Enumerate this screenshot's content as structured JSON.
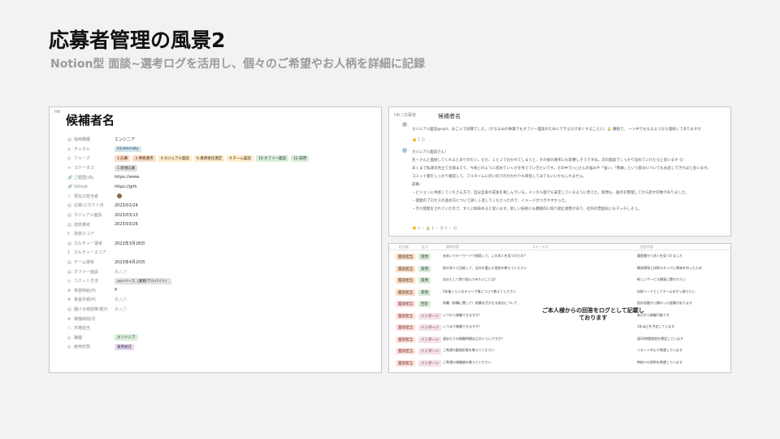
{
  "slide": {
    "title": "応募者管理の風景2",
    "subtitle": "Notion型 面談~選考ログを活用し、個々のご希望やお人柄を詳細に記録"
  },
  "left_panel": {
    "top_label": "HR",
    "page_title": "候補者名",
    "properties": [
      {
        "icon": "▤",
        "name": "採用職種",
        "values": [
          {
            "text": "エンジニア",
            "color": "plain"
          }
        ]
      },
      {
        "icon": "◎",
        "name": "チャネル",
        "values": [
          {
            "text": "01referralty",
            "color": "blue"
          }
        ]
      },
      {
        "icon": "◎",
        "name": "フェーズ",
        "values": [
          {
            "text": "1.応募",
            "color": "orange"
          },
          {
            "text": "3.事務選考",
            "color": "orange"
          },
          {
            "text": "4.カジュアル面談",
            "color": "yellow"
          },
          {
            "text": "6.業務委託選定",
            "color": "yellow"
          },
          {
            "text": "9.チーム面談",
            "color": "yellow"
          },
          {
            "text": "10.オファー面談",
            "color": "green"
          },
          {
            "text": "12.取用",
            "color": "green"
          }
        ]
      },
      {
        "icon": "✳",
        "name": "ステータス",
        "values": [
          {
            "text": "1.新規応募",
            "color": "gray"
          }
        ]
      },
      {
        "icon": "🔗",
        "name": "ご経歴URL",
        "values": [
          {
            "text": "https://www.",
            "color": "plain"
          }
        ]
      },
      {
        "icon": "🔗",
        "name": "Github",
        "values": [
          {
            "text": "https://gith",
            "color": "plain"
          }
        ]
      },
      {
        "icon": "⚇",
        "name": "現在の担当者",
        "values": [
          {
            "text": "",
            "color": "plain"
          }
        ]
      },
      {
        "icon": "▤",
        "name": "応募/スカウト日",
        "values": [
          {
            "text": "2023/02/24",
            "color": "plain"
          }
        ]
      },
      {
        "icon": "▤",
        "name": "カジュアル面談",
        "values": [
          {
            "text": "2023/03/13",
            "color": "plain"
          }
        ]
      },
      {
        "icon": "▤",
        "name": "技術選考",
        "values": [
          {
            "text": "2023/03/26",
            "color": "plain"
          }
        ]
      },
      {
        "icon": "Σ",
        "name": "技術スコア",
        "values": [
          {
            "text": "",
            "color": "plain"
          }
        ]
      },
      {
        "icon": "▤",
        "name": "カルチャー選考",
        "values": [
          {
            "text": "2023年3月26日",
            "color": "plain"
          }
        ]
      },
      {
        "icon": "Σ",
        "name": "カルチャースコア",
        "values": [
          {
            "text": "",
            "color": "plain"
          }
        ]
      },
      {
        "icon": "▤",
        "name": "チーム選考",
        "values": [
          {
            "text": "2023年4月20日",
            "color": "plain"
          }
        ]
      },
      {
        "icon": "▤",
        "name": "オファー面談",
        "values": [
          {
            "text": "未入力",
            "color": "muted"
          }
        ]
      },
      {
        "icon": "◎",
        "name": "コミット方法",
        "values": [
          {
            "text": "os×ベース（業務/アルバイト）",
            "color": "gray"
          }
        ]
      },
      {
        "icon": "#",
        "name": "希望時給/円",
        "values": [
          {
            "text": "¥",
            "color": "plain"
          }
        ]
      },
      {
        "icon": "#",
        "name": "希望月額/円",
        "values": [
          {
            "text": "未入力",
            "color": "muted"
          }
        ]
      },
      {
        "icon": "▤",
        "name": "働ける時間帯/曜日",
        "values": [
          {
            "text": "未入力",
            "color": "muted"
          }
        ]
      },
      {
        "icon": "#",
        "name": "稼働時間/月",
        "values": [
          {
            "text": "",
            "color": "plain"
          }
        ]
      },
      {
        "icon": "⚇",
        "name": "市場担当",
        "values": [
          {
            "text": "",
            "color": "plain"
          }
        ]
      },
      {
        "icon": "◎",
        "name": "職種",
        "values": [
          {
            "text": "エンジニア",
            "color": "green"
          }
        ]
      },
      {
        "icon": "◎",
        "name": "雇用形態",
        "values": [
          {
            "text": "業務委託",
            "color": "purple"
          }
        ]
      }
    ]
  },
  "top_right_panel": {
    "breadcrumb": "HR / 応募者",
    "page_title": "候補者名",
    "comment1": {
      "author": "",
      "lines": [
        "カジュアル面談@sqrt、おご入で役職でした。（がるるみの事業でもオファー面談のためにできるだけ早くすることに）🙏 番組で。 〜ト中でもなるようなら連絡してありますか"
      ],
      "reactions": "👍 1 ☺"
    },
    "comment2": {
      "lines": [
        "カジュアル面談さん！",
        "先ーさんと面接してくれるとありがたい。ただ、１と２で分かれてしまうと、その後の選考にも影響しそうですね。次の面談でしっかり詰めていけたらと思います 😊",
        "あくまで私達の見立てを踏まえて、今後どのように進めていくかを考えていきたいです。その中で○○さんの強みや「強い」「熟練」という部分についてもお話しできればと思います。",
        "コミット量をしっかり確認して、フルタイムに近い形でのかかわりも目指してみてもいいかもしれません。",
        "前職：",
        "・ビジョンに共感してくださる方で、自分自身の成長を楽しんでいる。メンタル面でも安定しているように見えた。質問も、論点を整理してから話す印象がありました。",
        "・開発のプロセスの進め方について詳しく話してくださったので、イメージがつきやすかった。",
        "・元々開発をされていたので、すぐに馴染めると思います。新しい技術にも積極的に取り組む姿勢があり、社内の雰囲気にもマッチしそう。"
      ],
      "reactions": "👏 1 ・ 🙏 1 ・ 😊 1 ・ ☺"
    }
  },
  "bottom_right_panel": {
    "columns": [
      "担当者",
      "区分",
      "質問内容",
      "ステータス",
      "回答内容"
    ],
    "annotation": "ご本人様からの回答をログとして記載しております",
    "rows": [
      {
        "c1": "面談担当",
        "c1c": "orange",
        "c2": "質問",
        "c2c": "green",
        "c3": "ああいうキーワードで検索して、この求人を見つけたの？",
        "c4": "履歴書から求人を見つけました"
      },
      {
        "c1": "面談担当",
        "c1c": "orange",
        "c2": "質問",
        "c2c": "green",
        "c3": "他の求人と比較して、当社を選んだ理由を教えてください",
        "c4": "開発環境と技術スタックに興味を持ったため"
      },
      {
        "c1": "面談担当",
        "c1c": "orange",
        "c2": "質問",
        "c2c": "green",
        "c3": "自分として取り組んでみたいことは？",
        "c4": "新しいサービス開発に関わりたい"
      },
      {
        "c1": "面談担当",
        "c1c": "orange",
        "c2": "質問",
        "c2c": "green",
        "c3": "5年後くらいのキャリア像について教えてください",
        "c4": "技術リードとしてチームを引っ張りたい"
      },
      {
        "c1": "面談担当",
        "c1c": "red",
        "c2": "回答",
        "c2c": "green",
        "c3": "前職（前職に関して）経験を活かせる部分について",
        "c4": "設計段階から携わった経験があります"
      },
      {
        "c1": "面談担当",
        "c1c": "red",
        "c2": "インターン",
        "c2c": "pink",
        "c3": "いつから稼働できますか？",
        "c4": "来月から稼働可能です"
      },
      {
        "c1": "面談担当",
        "c1c": "red",
        "c2": "インターン",
        "c2c": "pink",
        "c3": "いつまで稼働できますか？",
        "c4": "1年ほどを予定しています"
      },
      {
        "c1": "面談担当",
        "c1c": "red",
        "c2": "インターン",
        "c2c": "pink",
        "c3": "週あたりの稼働時間はどのくらいですか？",
        "c4": "週20時間程度を想定しています"
      },
      {
        "c1": "面談担当",
        "c1c": "red",
        "c2": "インターン",
        "c2c": "pink",
        "c3": "ご希望の勤務形態を教えてください",
        "c4": "リモート中心で希望しています"
      },
      {
        "c1": "面談担当",
        "c1c": "red",
        "c2": "インターン",
        "c2c": "pink",
        "c3": "ご希望の報酬額を教えてください",
        "c4": "時給での契約を希望しています"
      }
    ]
  }
}
